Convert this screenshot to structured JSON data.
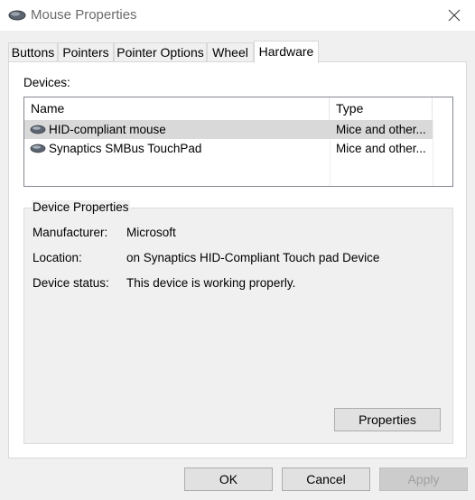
{
  "window": {
    "title": "Mouse Properties"
  },
  "tabs": [
    {
      "label": "Buttons"
    },
    {
      "label": "Pointers"
    },
    {
      "label": "Pointer Options"
    },
    {
      "label": "Wheel"
    },
    {
      "label": "Hardware",
      "active": true
    }
  ],
  "devices": {
    "label": "Devices:",
    "columns": [
      "Name",
      "Type"
    ],
    "rows": [
      {
        "name": "HID-compliant mouse",
        "type": "Mice and other...",
        "selected": true,
        "icon": "mouse-icon"
      },
      {
        "name": "Synaptics SMBus TouchPad",
        "type": "Mice and other...",
        "selected": false,
        "icon": "mouse-icon"
      }
    ]
  },
  "device_properties": {
    "legend": "Device Properties",
    "fields": [
      {
        "key": "Manufacturer:",
        "value": "Microsoft"
      },
      {
        "key": "Location:",
        "value": "on Synaptics HID-Compliant Touch pad Device"
      },
      {
        "key": "Device status:",
        "value": "This device is working properly."
      }
    ],
    "properties_button": "Properties"
  },
  "footer": {
    "ok": "OK",
    "cancel": "Cancel",
    "apply": "Apply",
    "apply_disabled": true
  },
  "icons": {
    "title": "mouse-icon",
    "close": "close-icon"
  },
  "colors": {
    "selected_row": "#d9d9d9",
    "title_text": "#6b6b6b",
    "window_bg": "#f0f0f0"
  }
}
